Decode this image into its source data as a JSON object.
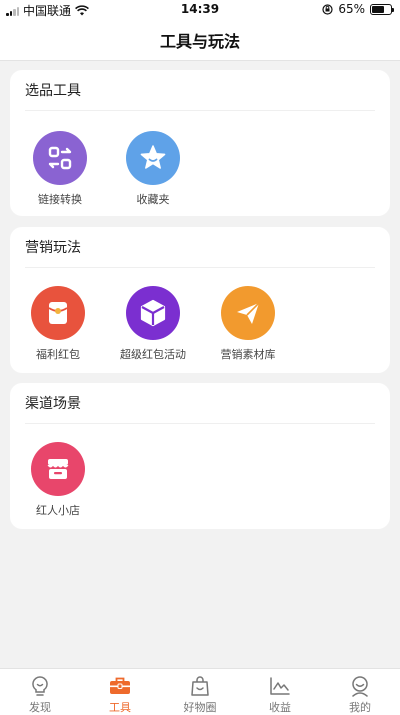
{
  "status_bar": {
    "carrier": "中国联通",
    "time": "14:39",
    "battery": "65%",
    "battery_level": 0.65
  },
  "header": {
    "title": "工具与玩法"
  },
  "sections": [
    {
      "title": "选品工具",
      "tools": [
        {
          "label": "链接转换",
          "icon": "link-convert-icon",
          "color": "#8a63d2"
        },
        {
          "label": "收藏夹",
          "icon": "star-favorites-icon",
          "color": "#5fa2e8"
        }
      ]
    },
    {
      "title": "营销玩法",
      "tools": [
        {
          "label": "福利红包",
          "icon": "red-envelope-icon",
          "color": "#e8533d"
        },
        {
          "label": "超级红包活动",
          "icon": "cube-icon",
          "color": "#7b2fd0"
        },
        {
          "label": "营销素材库",
          "icon": "paper-plane-icon",
          "color": "#f29a2e"
        }
      ]
    },
    {
      "title": "渠道场景",
      "tools": [
        {
          "label": "红人小店",
          "icon": "shop-icon",
          "color": "#e8466b"
        }
      ]
    }
  ],
  "tab_bar": {
    "items": [
      {
        "label": "发现",
        "icon": "bulb-icon",
        "active": false
      },
      {
        "label": "工具",
        "icon": "toolbox-icon",
        "active": true
      },
      {
        "label": "好物圈",
        "icon": "bag-icon",
        "active": false
      },
      {
        "label": "收益",
        "icon": "chart-icon",
        "active": false
      },
      {
        "label": "我的",
        "icon": "profile-icon",
        "active": false
      }
    ],
    "active_color": "#ee6a2c",
    "inactive_color": "#777777"
  }
}
